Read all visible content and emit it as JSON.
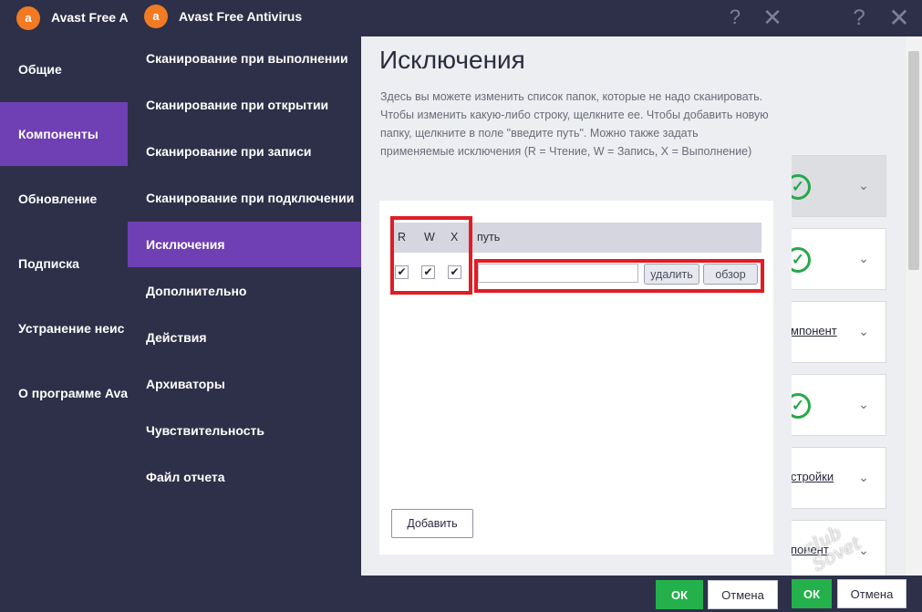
{
  "app": {
    "title_short": "Avast Free A",
    "title_full": "Avast Free Antivirus"
  },
  "left_nav": [
    "Общие",
    "Компоненты",
    "Обновление",
    "Подписка",
    "Устранение неис",
    "О программе Ava"
  ],
  "mid_nav": [
    "Сканирование при выполнении",
    "Сканирование при открытии",
    "Сканирование при записи",
    "Сканирование при подключении",
    "Исключения",
    "Дополнительно",
    "Действия",
    "Архиваторы",
    "Чувствительность",
    "Файл отчета"
  ],
  "content": {
    "title": "Исключения",
    "description": "Здесь вы можете изменить список папок, которые не надо сканировать. Чтобы изменить какую-либо строку, щелкните ее. Чтобы добавить новую папку, щелкните в поле \"введите путь\". Можно также задать применяемые исключения (R = Чтение, W = Запись, X = Выполнение)",
    "table": {
      "headers": [
        "R",
        "W",
        "X",
        "путь"
      ],
      "row": {
        "r": true,
        "w": true,
        "x": true,
        "path": ""
      }
    },
    "delete_label": "удалить",
    "browse_label": "обзор",
    "add_label": "Добавить"
  },
  "footer": {
    "ok_label": "ОК",
    "cancel_label": "Отмена"
  },
  "back_panel": {
    "links": [
      "мпонент",
      "стройки",
      "понент"
    ]
  },
  "watermark": "club Sovet",
  "icons": {
    "logo": "a",
    "help": "?",
    "close": "✕",
    "check": "✔",
    "chevron": "⌄",
    "ok_circle": "✓"
  },
  "colors": {
    "sidebar_bg": "#2d3048",
    "active_purple": "#6f3fb4",
    "avast_orange": "#f27a22",
    "ok_green": "#24b14c",
    "highlight_red": "#e11c24"
  }
}
